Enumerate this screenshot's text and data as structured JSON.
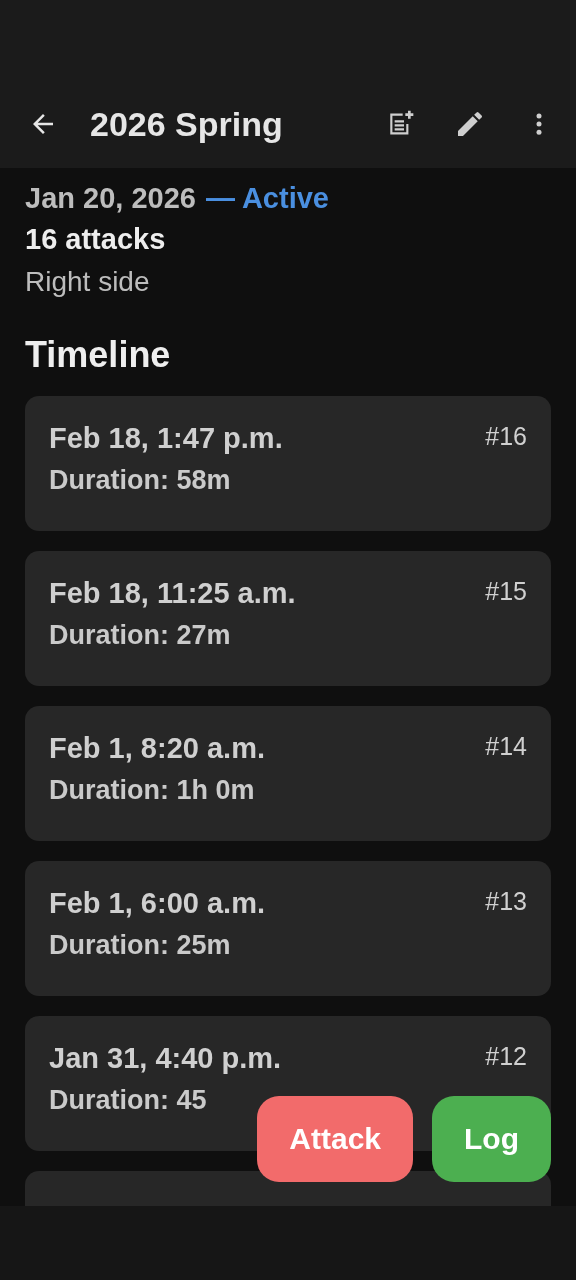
{
  "app_bar": {
    "title": "2026 Spring"
  },
  "summary": {
    "start_date": "Jan 20, 2026",
    "status": "— Active",
    "attacks": "16 attacks",
    "side": "Right side"
  },
  "timeline": {
    "heading": "Timeline",
    "entries": [
      {
        "time": "Feb 18, 1:47 p.m.",
        "duration": "Duration: 58m",
        "number": "#16"
      },
      {
        "time": "Feb 18, 11:25 a.m.",
        "duration": "Duration: 27m",
        "number": "#15"
      },
      {
        "time": "Feb 1, 8:20 a.m.",
        "duration": "Duration: 1h 0m",
        "number": "#14"
      },
      {
        "time": "Feb 1, 6:00 a.m.",
        "duration": "Duration: 25m",
        "number": "#13"
      },
      {
        "time": "Jan 31, 4:40 p.m.",
        "duration": "Duration: 45",
        "number": "#12"
      }
    ]
  },
  "actions": [
    {
      "label": "Attack",
      "kind": "danger"
    },
    {
      "label": "Log",
      "kind": "success"
    }
  ]
}
